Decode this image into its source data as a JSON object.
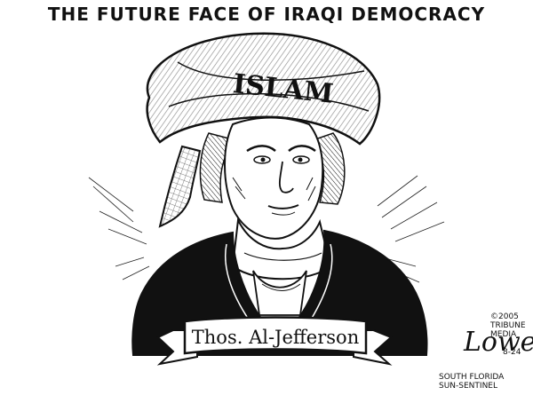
{
  "title": "THE FUTURE FACE OF IRAQI DEMOCRACY",
  "hat_label": "ISLAM",
  "banner_label": "Thos. Al-Jefferson",
  "copyright": "©2005",
  "syndicate_line1": "TRIBUNE",
  "syndicate_line2": "MEDIA",
  "date": "8-24",
  "newspaper_line1": "SOUTH FLORIDA",
  "newspaper_line2": "SUN-SENTINEL"
}
